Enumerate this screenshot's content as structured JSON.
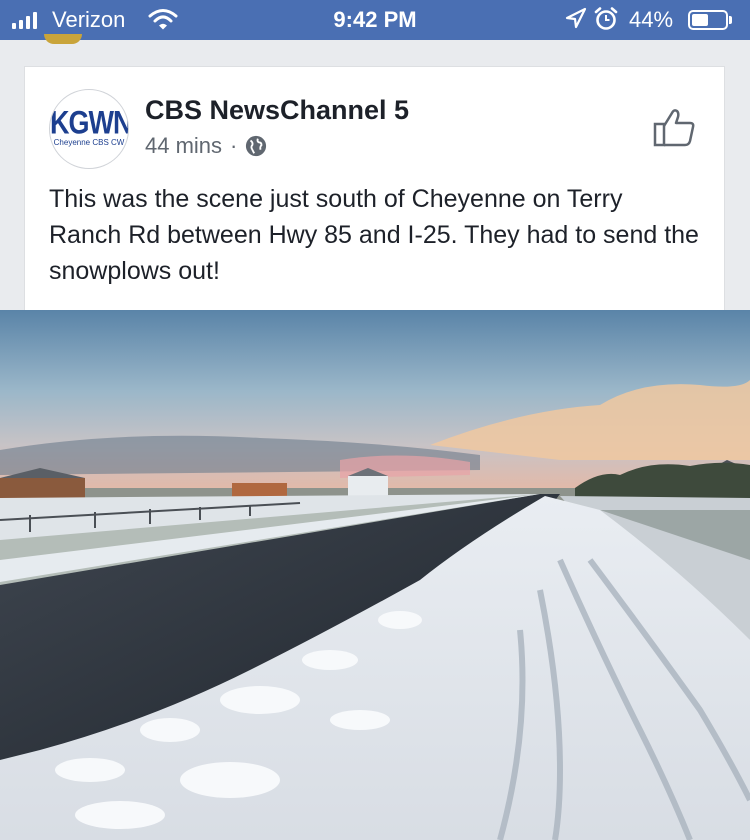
{
  "status_bar": {
    "carrier": "Verizon",
    "time": "9:42 PM",
    "battery_pct": "44%",
    "battery_level": 0.44
  },
  "post": {
    "author": "CBS NewsChannel 5",
    "time_ago": "44 mins",
    "separator": "·",
    "text": "This was the scene just south of Cheyenne on Terry Ranch Rd between Hwy 85 and I-25. They had to send the snowplows out!",
    "avatar": {
      "logo_main": "KGWN",
      "logo_sub": "Cheyenne CBS CW"
    }
  },
  "colors": {
    "status_bar": "#4a6fb3",
    "brand_blue": "#1d3f8f",
    "text": "#1d2129",
    "meta": "#606770"
  },
  "icons": [
    "signal-icon",
    "wifi-icon",
    "location-icon",
    "alarm-icon",
    "battery-icon",
    "globe-icon",
    "like-icon"
  ]
}
